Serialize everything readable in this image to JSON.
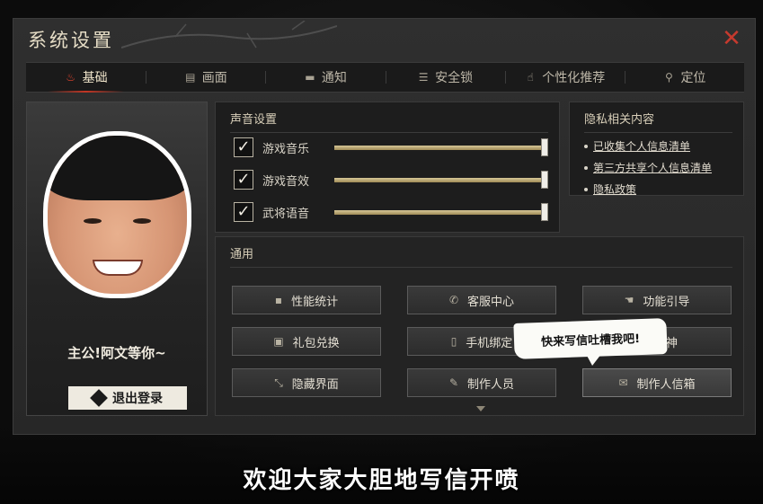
{
  "window": {
    "title": "系统设置",
    "close_icon": "close-icon"
  },
  "tabs": [
    {
      "label": "基础",
      "icon": "flame-icon",
      "active": true
    },
    {
      "label": "画面",
      "icon": "monitor-icon",
      "active": false
    },
    {
      "label": "通知",
      "icon": "chat-bubble-icon",
      "active": false
    },
    {
      "label": "安全锁",
      "icon": "lock-icon",
      "active": false
    },
    {
      "label": "个性化推荐",
      "icon": "thumbs-up-icon",
      "active": false
    },
    {
      "label": "定位",
      "icon": "location-pin-icon",
      "active": false
    }
  ],
  "profile": {
    "caption": "主公!阿文等你~",
    "logout_label": "退出登录"
  },
  "sound": {
    "title": "声音设置",
    "items": [
      {
        "label": "游戏音乐",
        "checked": true,
        "level": 1.0
      },
      {
        "label": "游戏音效",
        "checked": true,
        "level": 1.0
      },
      {
        "label": "武将语音",
        "checked": true,
        "level": 1.0
      }
    ],
    "check_glyph": "✓"
  },
  "privacy": {
    "title": "隐私相关内容",
    "links": [
      "已收集个人信息清单",
      "第三方共享个人信息清单",
      "隐私政策"
    ]
  },
  "general": {
    "title": "通用",
    "buttons": [
      {
        "label": "性能统计",
        "icon": "chat-dots-icon",
        "glyph": "▪"
      },
      {
        "label": "客服中心",
        "icon": "phone-icon",
        "glyph": "✆"
      },
      {
        "label": "功能引导",
        "icon": "hand-pointer-icon",
        "glyph": "☚"
      },
      {
        "label": "礼包兑换",
        "icon": "gift-icon",
        "glyph": "▣"
      },
      {
        "label": "手机绑定",
        "icon": "mobile-phone-icon",
        "glyph": "▯"
      },
      {
        "label": "大神",
        "icon": "star-icon",
        "glyph": "✦"
      },
      {
        "label": "隐藏界面",
        "icon": "resize-arrows-icon",
        "glyph": "⤡"
      },
      {
        "label": "制作人员",
        "icon": "feather-icon",
        "glyph": "✎"
      },
      {
        "label": "制作人信箱",
        "icon": "envelope-icon",
        "glyph": "✉"
      }
    ]
  },
  "speech_bubble": "快来写信吐槽我吧!",
  "subtitle": "欢迎大家大胆地写信开喷",
  "colors": {
    "accent_red": "#c63a2e",
    "gold_slider": "#c9b883"
  }
}
